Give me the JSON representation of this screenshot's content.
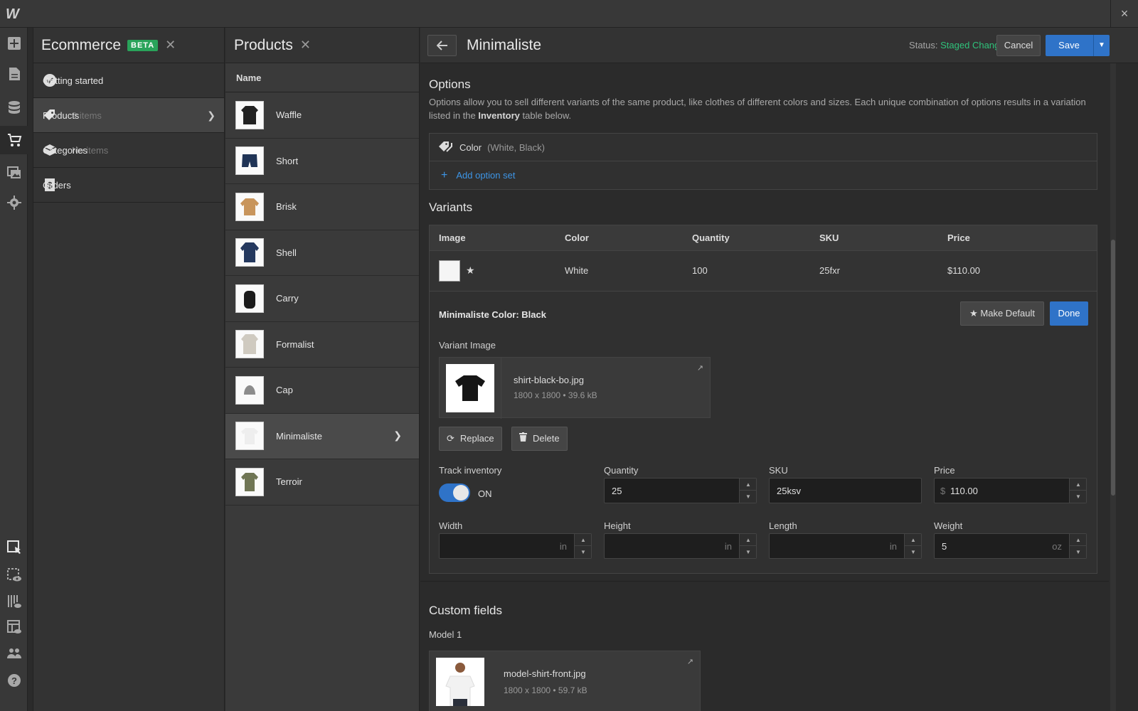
{
  "app": {
    "logo": "W",
    "close_icon": "×"
  },
  "rail": {
    "icons": [
      "add-icon",
      "page-icon",
      "database-icon",
      "cart-icon",
      "assets-icon",
      "settings-icon"
    ],
    "bottom_icons": [
      "select-icon",
      "preview-icon",
      "audit-icon",
      "layout-preview-icon",
      "users-icon",
      "help-icon"
    ]
  },
  "ecommerce": {
    "title": "Ecommerce",
    "badge": "BETA",
    "items": [
      {
        "label": "Getting started",
        "count": ""
      },
      {
        "label": "Products",
        "count": "9 items"
      },
      {
        "label": "Categories",
        "count": "No items"
      },
      {
        "label": "Orders",
        "count": ""
      }
    ]
  },
  "products": {
    "title": "Products",
    "column": "Name",
    "rows": [
      "Waffle",
      "Short",
      "Brisk",
      "Shell",
      "Carry",
      "Formalist",
      "Cap",
      "Minimaliste",
      "Terroir"
    ]
  },
  "editor": {
    "title": "Minimaliste",
    "status_label": "Status:",
    "status_value": "Staged Changes",
    "cancel": "Cancel",
    "save": "Save",
    "options": {
      "heading": "Options",
      "desc_a": "Options allow you to sell different variants of the same product, like clothes of different colors and sizes. Each unique combination of options results in a variation listed in the ",
      "desc_b": "Inventory",
      "desc_c": " table below.",
      "option_name": "Color",
      "option_values": "(White, Black)",
      "add_label": "Add option set"
    },
    "variants": {
      "heading": "Variants",
      "columns": [
        "Image",
        "Color",
        "Quantity",
        "SKU",
        "Price"
      ],
      "row": {
        "color": "White",
        "quantity": "100",
        "sku": "25fxr",
        "price": "$110.00"
      },
      "edit_title": "Minimaliste Color: Black",
      "make_default": "Make Default",
      "done": "Done",
      "variant_image_label": "Variant Image",
      "image_name": "shirt-black-bo.jpg",
      "image_meta": "1800 x 1800 • 39.6 kB",
      "replace": "Replace",
      "delete": "Delete",
      "track_inventory_label": "Track inventory",
      "track_inventory_state": "ON",
      "quantity_label": "Quantity",
      "quantity_value": "25",
      "sku_label": "SKU",
      "sku_value": "25ksv",
      "price_label": "Price",
      "price_currency": "$",
      "price_value": "110.00",
      "width_label": "Width",
      "height_label": "Height",
      "length_label": "Length",
      "weight_label": "Weight",
      "weight_value": "5",
      "unit_in": "in",
      "unit_oz": "oz"
    },
    "custom": {
      "heading": "Custom fields",
      "field_label": "Model 1",
      "image_name": "model-shirt-front.jpg",
      "image_meta": "1800 x 1800 • 59.7 kB"
    }
  },
  "colors": {
    "accent": "#2f73c8",
    "status_green": "#2fc37b",
    "beta_green": "#29a35a"
  }
}
